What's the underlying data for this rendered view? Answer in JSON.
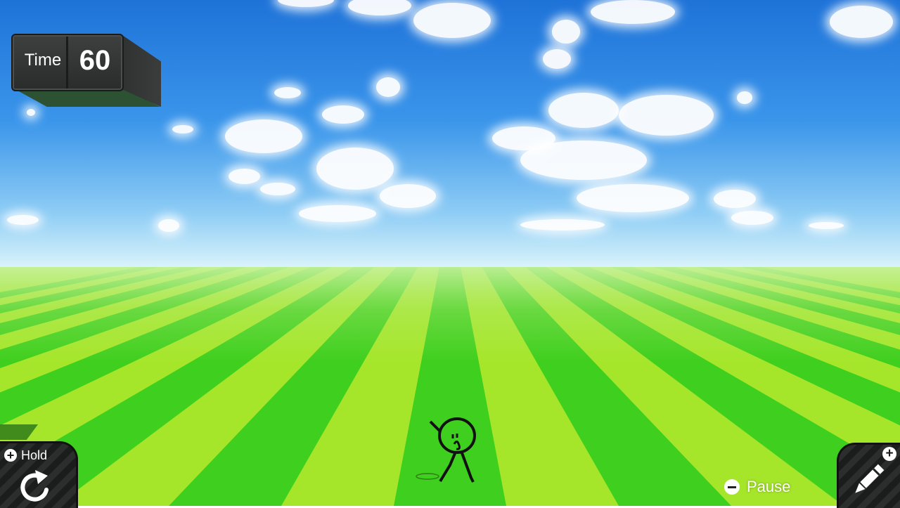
{
  "hud": {
    "time_label": "Time",
    "time_value": "60",
    "hold_label": "Hold",
    "hold_button_icon": "plus-icon",
    "pause_label": "Pause",
    "pause_button_icon": "minus-icon",
    "draw_button_icon": "pencil-icon"
  },
  "scene": {
    "sky_color_top": "#1f73d8",
    "sky_color_horizon": "#d9f3fb",
    "grass_light": "#a6e62a",
    "grass_dark": "#3fcf1e"
  }
}
